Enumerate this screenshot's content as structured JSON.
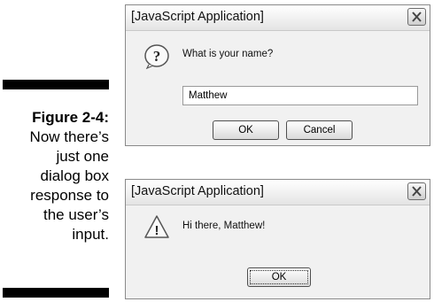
{
  "caption": {
    "figure": "Figure 2-4:",
    "lines": [
      "Now there’s",
      "just one",
      "dialog box",
      "response to",
      "the user’s",
      "input."
    ]
  },
  "prompt_dialog": {
    "title": "[JavaScript Application]",
    "message": "What is your name?",
    "input_value": "Matthew",
    "ok_label": "OK",
    "cancel_label": "Cancel",
    "icon": "question-icon"
  },
  "alert_dialog": {
    "title": "[JavaScript Application]",
    "message": "Hi there, Matthew!",
    "ok_label": "OK",
    "icon": "warning-icon"
  }
}
